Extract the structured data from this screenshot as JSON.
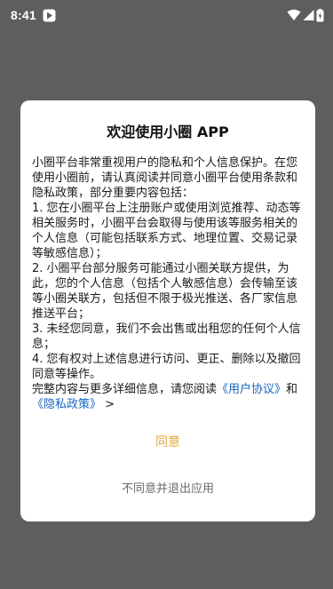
{
  "status_bar": {
    "time": "8:41",
    "icons": [
      "app-notification-icon",
      "wifi-icon",
      "signal-icon",
      "battery-icon"
    ]
  },
  "dialog": {
    "title": "欢迎使用小圈 APP",
    "paragraphs": [
      "小圈平台非常重视用户的隐私和个人信息保护。在您使用小圈前，请认真阅读并同意小圈平台使用条款和隐私政策，部分重要内容包括：",
      "1. 您在小圈平台上注册账户或使用浏览推荐、动态等相关服务时，小圈平台会取得与使用该等服务相关的个人信息（可能包括联系方式、地理位置、交易记录等敏感信息）；",
      "2. 小圈平台部分服务可能通过小圈关联方提供，为此，您的个人信息（包括个人敏感信息）会传输至该等小圈关联方，包括但不限于极光推送、各厂家信息推送平台；",
      "3. 未经您同意，我们不会出售或出租您的任何个人信息；",
      "4. 您有权对上述信息进行访问、更正、删除以及撤回同意等操作。"
    ],
    "final_prefix": "完整内容与更多详细信息，请您阅读",
    "user_agreement_link": "《用户协议》",
    "and_text": "和",
    "privacy_policy_link": "《隐私政策》",
    "final_suffix": " >",
    "agree_label": "同意",
    "decline_label": "不同意并退出应用"
  }
}
